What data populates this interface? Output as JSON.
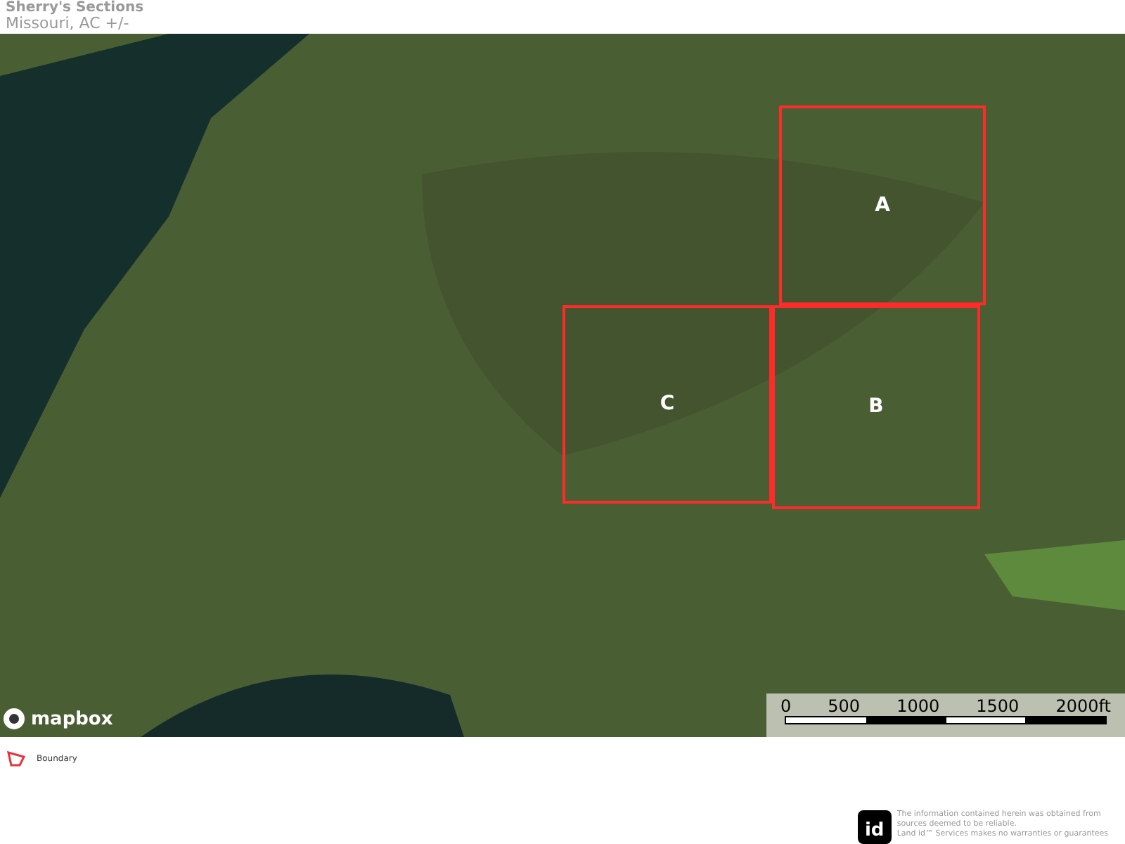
{
  "header": {
    "title": "Sherry's Sections",
    "subtitle": "Missouri,  AC +/-"
  },
  "map": {
    "attribution": "mapbox",
    "parcels": [
      {
        "label": "A",
        "color": "#ff2a2a"
      },
      {
        "label": "B",
        "color": "#ff2a2a"
      },
      {
        "label": "C",
        "color": "#ff2a2a"
      }
    ],
    "scale": {
      "ticks": [
        "0",
        "500",
        "1000",
        "1500",
        "2000ft"
      ]
    }
  },
  "legend": [
    {
      "label": "Boundary",
      "color": "#e8323c"
    }
  ],
  "footer": {
    "logo": "id",
    "disclaimer": [
      "The information contained herein was obtained from",
      "sources deemed to be reliable.",
      "Land id™ Services makes no warranties or guarantees"
    ]
  }
}
